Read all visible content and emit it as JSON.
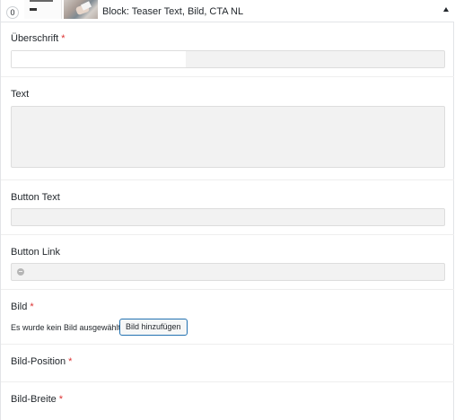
{
  "block": {
    "order": "0",
    "title": "Block: Teaser Text, Bild, CTA NL"
  },
  "fields": {
    "heading": {
      "label": "Überschrift",
      "required": "*",
      "value": ""
    },
    "text": {
      "label": "Text",
      "value": ""
    },
    "button_text": {
      "label": "Button Text",
      "value": ""
    },
    "button_link": {
      "label": "Button Link",
      "value": ""
    },
    "image": {
      "label": "Bild",
      "required": "*",
      "empty_note": "Es wurde kein Bild ausgewählt",
      "add_button": "Bild hinzufügen"
    },
    "image_position": {
      "label": "Bild-Position",
      "required": "*"
    },
    "image_width": {
      "label": "Bild-Breite",
      "required": "*"
    }
  },
  "colors": {
    "required": "#dc3232",
    "button_border": "#2271b1"
  },
  "icons": {
    "toggle": "triangle-up-icon",
    "link": "link-icon"
  }
}
